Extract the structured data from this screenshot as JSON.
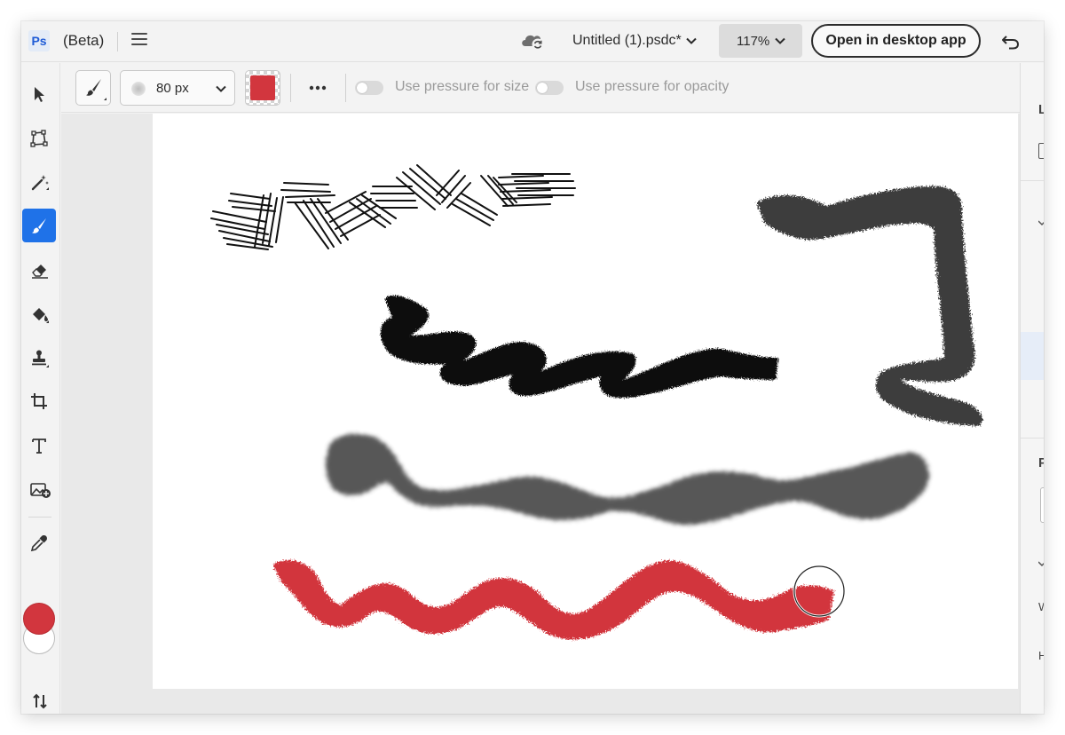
{
  "app": {
    "logo_text": "Ps",
    "beta_label": "(Beta)",
    "document_title": "Untitled (1).psdc*",
    "zoom_level": "117%",
    "open_desktop_label": "Open in desktop app"
  },
  "options_bar": {
    "brush_size": "80 px",
    "brush_color": "#d2363e",
    "pressure_size_label": "Use pressure for size",
    "pressure_opacity_label": "Use pressure for opacity",
    "pressure_size_on": false,
    "pressure_opacity_on": false
  },
  "tools": [
    {
      "name": "move-tool",
      "icon": "arrow-pointer-icon"
    },
    {
      "name": "transform-tool",
      "icon": "transform-icon"
    },
    {
      "name": "magic-wand-tool",
      "icon": "magic-wand-icon"
    },
    {
      "name": "brush-tool",
      "icon": "brush-icon",
      "active": true
    },
    {
      "name": "eraser-tool",
      "icon": "eraser-icon"
    },
    {
      "name": "paint-bucket-tool",
      "icon": "paint-bucket-icon"
    },
    {
      "name": "clone-stamp-tool",
      "icon": "stamp-icon"
    },
    {
      "name": "crop-tool",
      "icon": "crop-icon"
    },
    {
      "name": "type-tool",
      "icon": "type-icon"
    },
    {
      "name": "place-image-tool",
      "icon": "image-add-icon"
    },
    {
      "name": "eyedropper-tool",
      "icon": "eyedropper-icon"
    }
  ],
  "colors": {
    "foreground": "#d2363e",
    "background": "#ffffff",
    "accent": "#1f72e8"
  },
  "right_panel_fragments": [
    "L",
    "P",
    "W",
    "H"
  ]
}
